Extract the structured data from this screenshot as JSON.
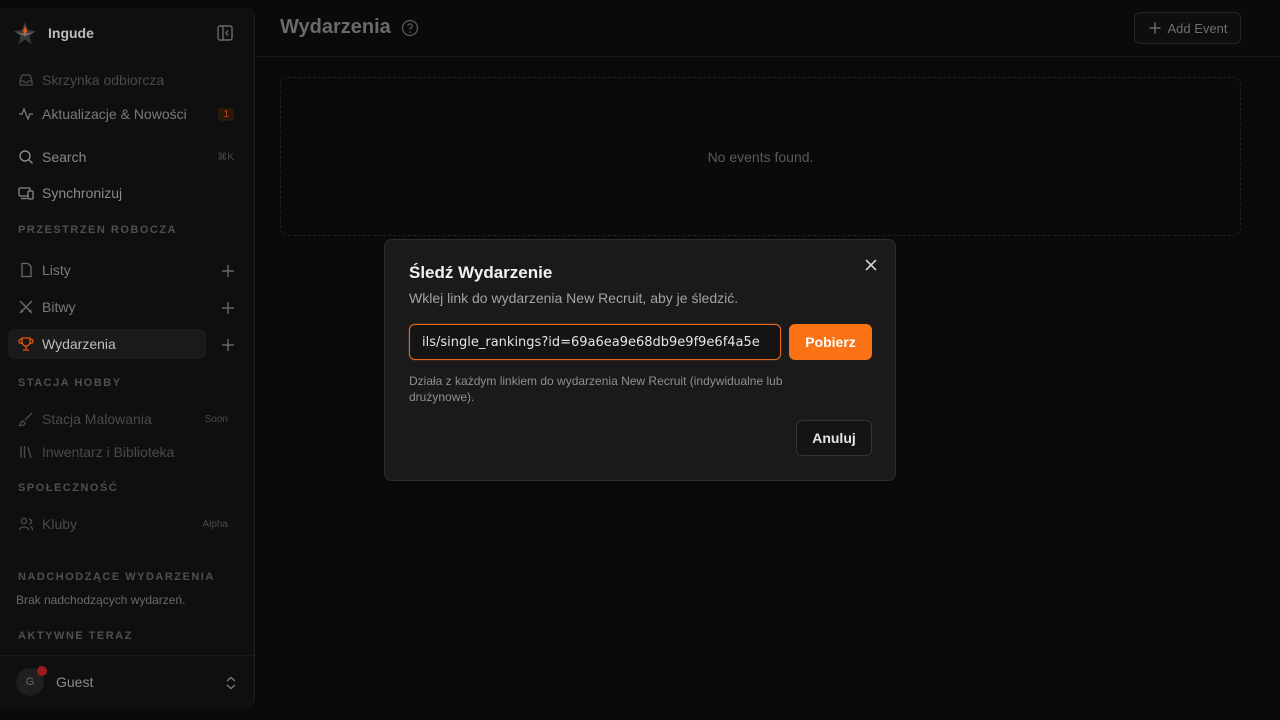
{
  "app": {
    "name": "Ingude",
    "accent_color": "#f97316"
  },
  "sidebar": {
    "items": [
      {
        "label": "Skrzynka odbiorcza",
        "icon": "inbox-icon"
      },
      {
        "label": "Aktualizacje & Nowości",
        "icon": "activity-icon",
        "badge": "1"
      },
      {
        "label": "Search",
        "icon": "search-icon",
        "shortcut": "⌘K"
      },
      {
        "label": "Synchronizuj",
        "icon": "devices-icon"
      }
    ],
    "workspace_title": "PRZESTRZEN ROBOCZA",
    "workspace_items": [
      {
        "label": "Listy",
        "icon": "file-icon"
      },
      {
        "label": "Bitwy",
        "icon": "swords-icon"
      },
      {
        "label": "Wydarzenia",
        "icon": "trophy-icon",
        "active": true
      }
    ],
    "hobby_title": "STACJA HOBBY",
    "hobby_items": [
      {
        "label": "Stacja Malowania",
        "icon": "brush-icon",
        "tag": "Soon"
      },
      {
        "label": "Inwentarz i Biblioteka",
        "icon": "library-icon"
      }
    ],
    "community_title": "SPOŁECZNOŚĆ",
    "community_items": [
      {
        "label": "Kluby",
        "icon": "users-icon",
        "tag": "Alpha"
      }
    ],
    "upcoming_title": "NADCHODZĄCE WYDARZENIA",
    "upcoming_empty": "Brak nadchodzących wydarzeń.",
    "active_title": "AKTYWNE TERAZ",
    "user": {
      "initial": "G",
      "name": "Guest"
    }
  },
  "main": {
    "title": "Wydarzenia",
    "add_event_label": "Add Event",
    "empty_text": "No events found."
  },
  "modal": {
    "title": "Śledź Wydarzenie",
    "description": "Wklej link do wydarzenia New Recruit, aby je śledzić.",
    "input_value": "ils/single_rankings?id=69a6ea9e68db9e9f9e6f4a5e",
    "fetch_label": "Pobierz",
    "hint": "Działa z każdym linkiem do wydarzenia New Recruit (indywidualne lub drużynowe).",
    "cancel_label": "Anuluj"
  }
}
